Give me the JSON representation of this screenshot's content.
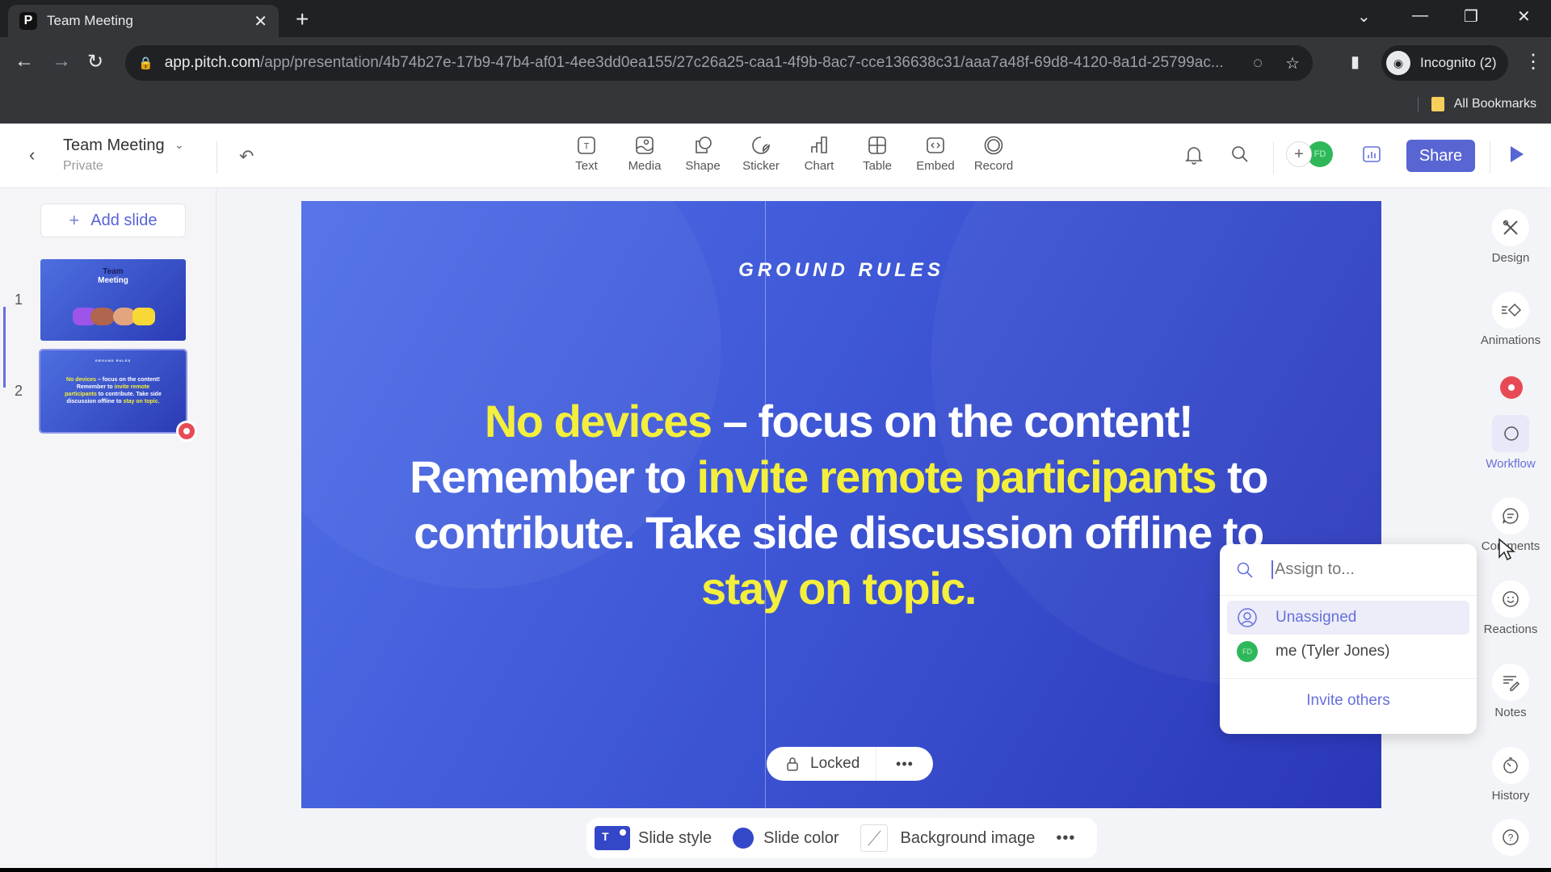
{
  "browser": {
    "tab_title": "Team Meeting",
    "favicon": "P",
    "url_host": "app.pitch.com",
    "url_path": "/app/presentation/4b74b27e-17b9-47b4-af01-4ee3dd0ea155/27c26a25-caa1-4f9b-8ac7-cce136638c31/aaa7a48f-69d8-4120-8a1d-25799ac...",
    "profile_label": "Incognito (2)",
    "bookmarks_label": "All Bookmarks"
  },
  "app": {
    "doc_title": "Team Meeting",
    "doc_visibility": "Private",
    "tools": [
      "Text",
      "Media",
      "Shape",
      "Sticker",
      "Chart",
      "Table",
      "Embed",
      "Record"
    ],
    "avatar_initials": "FD",
    "share_label": "Share"
  },
  "sidebar": {
    "add_slide_label": "Add slide",
    "slides": [
      {
        "number": "1",
        "title_line1": "Team",
        "title_line2": "Meeting"
      },
      {
        "number": "2",
        "heading": "GROUND RULES"
      }
    ]
  },
  "slide": {
    "heading": "GROUND RULES",
    "body": [
      {
        "text": "No devices",
        "highlight": true
      },
      {
        "text": " – focus on the content! Remember to ",
        "highlight": false
      },
      {
        "text": "invite remote participants",
        "highlight": true
      },
      {
        "text": " to contribute. Take side discussion offline to ",
        "highlight": false
      },
      {
        "text": "stay on topic.",
        "highlight": true
      }
    ],
    "highlight_color": "#f4ef3c",
    "background_color": "#3447c8",
    "locked_label": "Locked"
  },
  "bottombar": {
    "slide_style": "Slide style",
    "slide_color": "Slide color",
    "background_image": "Background image"
  },
  "rail": {
    "items": [
      "Design",
      "Animations",
      "Workflow",
      "Comments",
      "Reactions",
      "Notes",
      "History"
    ]
  },
  "assign_dropdown": {
    "placeholder": "Assign to...",
    "options": [
      {
        "label": "Unassigned"
      },
      {
        "label": "me (Tyler Jones)",
        "initials": "FD"
      }
    ],
    "invite_label": "Invite others"
  }
}
